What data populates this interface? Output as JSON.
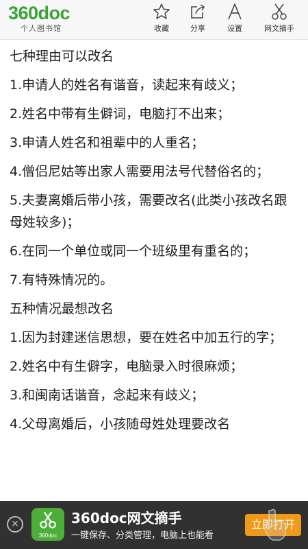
{
  "header": {
    "logo": "360doc",
    "logo_sub": "个人图书馆",
    "actions": [
      {
        "label": "收藏",
        "icon": "star-icon"
      },
      {
        "label": "分享",
        "icon": "share-icon"
      },
      {
        "label": "设置",
        "icon": "font-a-icon"
      },
      {
        "label": "网文摘手",
        "icon": "scissors-icon"
      }
    ]
  },
  "article": {
    "paragraphs": [
      "七种理由可以改名",
      "1.申请人的姓名有谐音，读起来有歧义；",
      "2.姓名中带有生僻词，电脑打不出来；",
      "3.申请人姓名和祖辈中的人重名；",
      "4.僧侣尼姑等出家人需要用法号代替俗名的；",
      "5.夫妻离婚后带小孩，需要改名(此类小孩改名跟母姓较多)；",
      "6.在同一个单位或同一个班级里有重名的；",
      "7.有特殊情况的。",
      "五种情况最想改名",
      "1.因为封建迷信思想，要在姓名中加五行的字；",
      "2.姓名中有生僻字，电脑录入时很麻烦；",
      "3.和闽南话谐音，念起来有歧义；",
      "4.父母离婚后，小孩随母姓处理要改名"
    ]
  },
  "banner": {
    "close": "✕",
    "icon_text": "360doc",
    "title": "360doc网文摘手",
    "subtitle": "一键保存、分类管理，电脑上也能看",
    "open_button": "立即打开"
  }
}
